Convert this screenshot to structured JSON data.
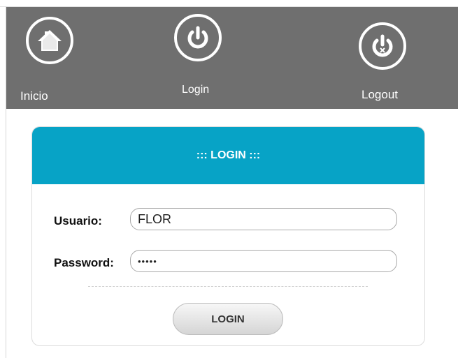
{
  "nav": {
    "items": [
      {
        "label": "Inicio",
        "icon": "home-icon"
      },
      {
        "label": "Login",
        "icon": "power-icon"
      },
      {
        "label": "Logout",
        "icon": "power-off-icon"
      }
    ]
  },
  "login_panel": {
    "title": "::: LOGIN :::",
    "username_label": "Usuario:",
    "username_value": "FLOR",
    "password_label": "Password:",
    "password_value": "•••••",
    "submit_label": "LOGIN"
  },
  "colors": {
    "navbar": "#6f6f6f",
    "panel_header": "#07a3c6"
  }
}
